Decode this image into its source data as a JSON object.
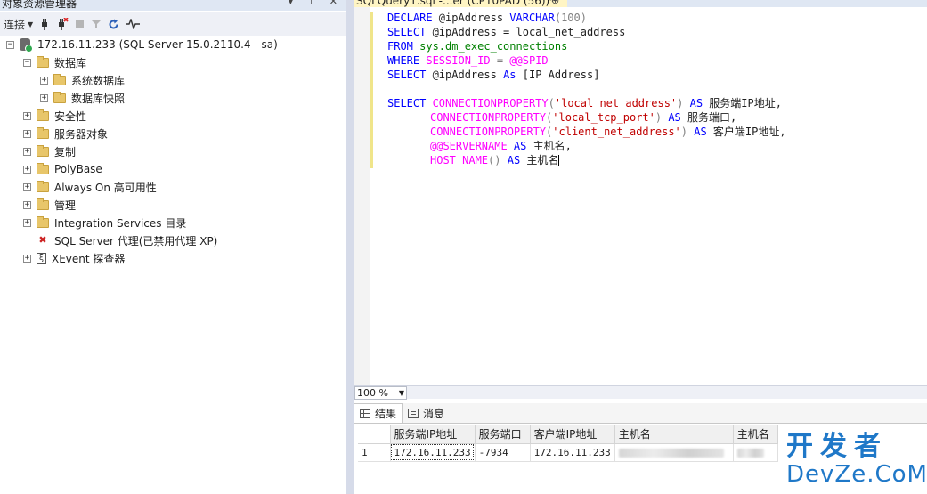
{
  "object_explorer": {
    "title": "对象资源管理器",
    "title_buttons": "▾ ⊥ ✕",
    "toolbar": {
      "connect_label": "连接",
      "icons": [
        "connect-plug-icon",
        "disconnect-icon",
        "stop-icon",
        "filter-icon",
        "refresh-icon",
        "activity-monitor-icon"
      ]
    },
    "tree": {
      "server": "172.16.11.233 (SQL Server 15.0.2110.4 - sa)",
      "databases": "数据库",
      "system_databases": "系统数据库",
      "database_snapshots": "数据库快照",
      "security": "安全性",
      "server_objects": "服务器对象",
      "replication": "复制",
      "polybase": "PolyBase",
      "always_on": "Always On 高可用性",
      "management": "管理",
      "integration_services": "Integration Services 目录",
      "sql_agent": "SQL Server 代理(已禁用代理 XP)",
      "xevent": "XEvent 探查器"
    }
  },
  "editor": {
    "tab_title": "SQLQuery1.sql -...er (CP10PAD (56))*",
    "tab_buttons": "⊕ ✕",
    "zoom": "100 %",
    "code": {
      "l1_kw": "DECLARE",
      "l1_var": " @ipAddress ",
      "l1_type": "VARCHAR",
      "l1_rest": "(100)",
      "l2_kw": "SELECT",
      "l2_rest": " @ipAddress = local_net_address",
      "l3_kw": "FROM",
      "l3_sys": " sys.dm_exec_connections",
      "l4_kw": "WHERE",
      "l4_fn": " SESSION_ID",
      "l4_eq": " = ",
      "l4_fn2": "@@SPID",
      "l5_kw": "SELECT",
      "l5_var": " @ipAddress ",
      "l5_kw2": "As",
      "l5_rest": " [IP Address]",
      "l7_kw": "SELECT",
      "l7_fn": " CONNECTIONPROPERTY",
      "l7_p1": "(",
      "l7_str": "'local_net_address'",
      "l7_p2": ") ",
      "l7_as": "AS",
      "l7_alias": " 服务端IP地址,",
      "l8_fn": "CONNECTIONPROPERTY",
      "l8_p1": "(",
      "l8_str": "'local_tcp_port'",
      "l8_p2": ") ",
      "l8_as": "AS",
      "l8_alias": " 服务端口,",
      "l9_fn": "CONNECTIONPROPERTY",
      "l9_p1": "(",
      "l9_str": "'client_net_address'",
      "l9_p2": ") ",
      "l9_as": "AS",
      "l9_alias": " 客户端IP地址,",
      "l10_fn": "@@SERVERNAME",
      "l10_as": " AS",
      "l10_alias": " 主机名,",
      "l11_fn": "HOST_NAME",
      "l11_p": "() ",
      "l11_as": "AS",
      "l11_alias": " 主机名"
    }
  },
  "results": {
    "tabs": [
      "结果",
      "消息"
    ],
    "columns": [
      "服务端IP地址",
      "服务端口",
      "客户端IP地址",
      "主机名",
      "主机名"
    ],
    "rows": [
      {
        "num": "1",
        "cells": [
          "172.16.11.233",
          "-7934",
          "172.16.11.233",
          "",
          ""
        ]
      }
    ]
  },
  "watermark": {
    "line1": "开发者",
    "line2": "DevZe.CoM"
  }
}
